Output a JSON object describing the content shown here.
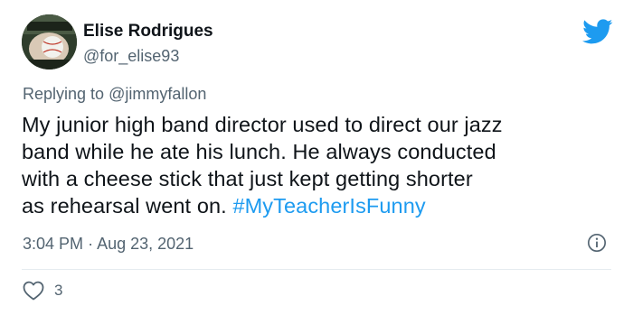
{
  "author": {
    "name": "Elise Rodrigues",
    "handle": "@for_elise93"
  },
  "reply": {
    "prefix": "Replying to",
    "mention": "@jimmyfallon"
  },
  "tweet": {
    "lines": [
      "My junior high band director used to direct our jazz",
      "band while he ate his lunch. He always conducted",
      "with a cheese stick that just kept getting shorter",
      "as rehearsal went on."
    ],
    "hashtag": "#MyTeacherIsFunny"
  },
  "meta": {
    "time": "3:04 PM",
    "separator": "·",
    "date": "Aug 23, 2021"
  },
  "engagement": {
    "likes": "3"
  },
  "colors": {
    "accent": "#1d9bf0",
    "text": "#0f1419",
    "secondary": "#536471"
  }
}
